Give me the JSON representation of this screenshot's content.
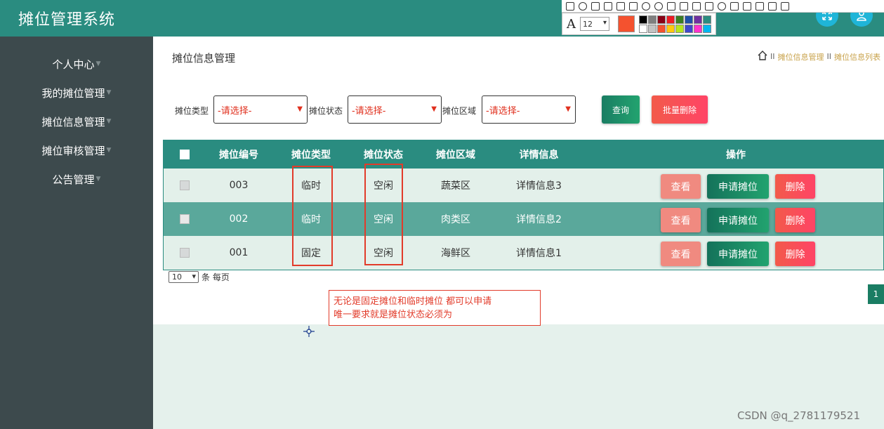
{
  "app": {
    "title": "摊位管理系统"
  },
  "header": {
    "fullscreen_icon": "expand-icon",
    "user_icon": "user-icon",
    "brand_color": "#2a8c80"
  },
  "snip_tool": {
    "font_icon": "A",
    "font_size": "12",
    "current_color": "#f4522f",
    "palette": [
      "#000000",
      "#7f7f7f",
      "#880015",
      "#ed1c24",
      "#3a7d22",
      "#1f4fa8",
      "#7030a0",
      "#2a8c80",
      "#ffffff",
      "#c3c3c3",
      "#f4522f",
      "#ffc90e",
      "#b5e61d",
      "#3f48cc",
      "#ff33cc",
      "#00b7ef"
    ]
  },
  "sidebar": {
    "items": [
      {
        "label": "个人中心"
      },
      {
        "label": "我的摊位管理"
      },
      {
        "label": "摊位信息管理"
      },
      {
        "label": "摊位审核管理"
      },
      {
        "label": "公告管理"
      }
    ]
  },
  "page": {
    "title": "摊位信息管理",
    "breadcrumb": [
      "摊位信息管理",
      "摊位信息列表"
    ],
    "breadcrumb_sep": "II"
  },
  "filters": {
    "type_label": "摊位类型",
    "type_value": "-请选择-",
    "status_label": "摊位状态",
    "status_value": "-请选择-",
    "area_label": "摊位区域",
    "area_value": "-请选择-",
    "query_label": "查询",
    "batch_delete_label": "批量删除"
  },
  "table": {
    "headers": [
      "摊位编号",
      "摊位类型",
      "摊位状态",
      "摊位区域",
      "详情信息",
      "操作"
    ],
    "rows": [
      {
        "id": "003",
        "type": "临时",
        "status": "空闲",
        "area": "蔬菜区",
        "detail": "详情信息3"
      },
      {
        "id": "002",
        "type": "临时",
        "status": "空闲",
        "area": "肉类区",
        "detail": "详情信息2"
      },
      {
        "id": "001",
        "type": "固定",
        "status": "空闲",
        "area": "海鲜区",
        "detail": "详情信息1"
      }
    ],
    "actions": {
      "view": "查看",
      "apply": "申请摊位",
      "delete": "删除"
    }
  },
  "pager": {
    "page_size": "10",
    "per_page_text": "条 每页",
    "current_page": "1"
  },
  "note": {
    "line1": "无论是固定摊位和临时摊位 都可以申请",
    "line2": "唯一要求就是摊位状态必须为"
  },
  "watermark": "CSDN @q_2781179521"
}
